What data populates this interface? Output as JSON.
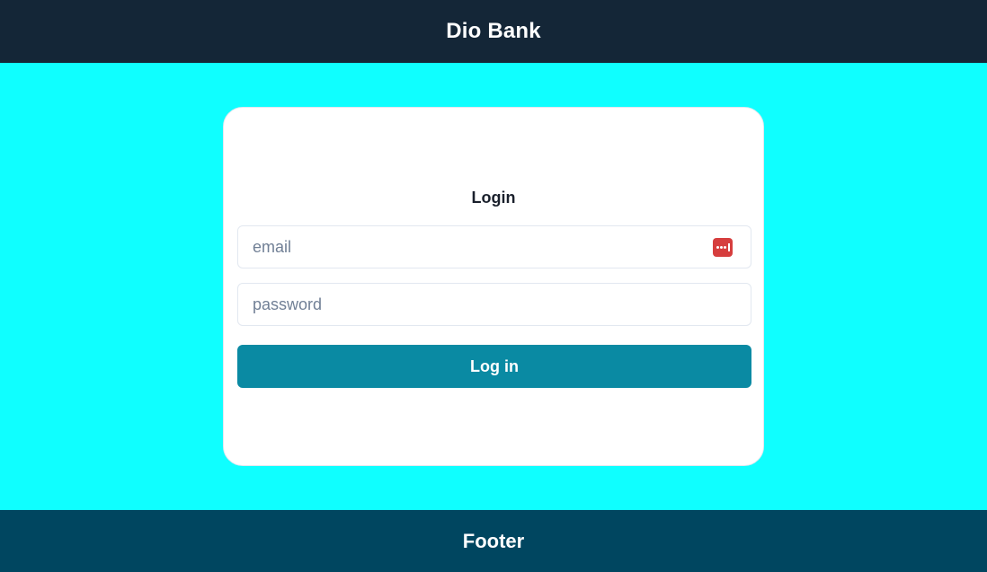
{
  "header": {
    "title": "Dio Bank"
  },
  "login_card": {
    "title": "Login",
    "email": {
      "placeholder": "email",
      "value": "",
      "icon": "password-manager-icon"
    },
    "password": {
      "placeholder": "password",
      "value": ""
    },
    "submit_label": "Log in"
  },
  "footer": {
    "text": "Footer"
  },
  "colors": {
    "header_bg": "#142637",
    "page_bg": "#0fffff",
    "button_bg": "#0a8aa3",
    "footer_bg": "#004660",
    "icon_red": "#d63e3e"
  }
}
